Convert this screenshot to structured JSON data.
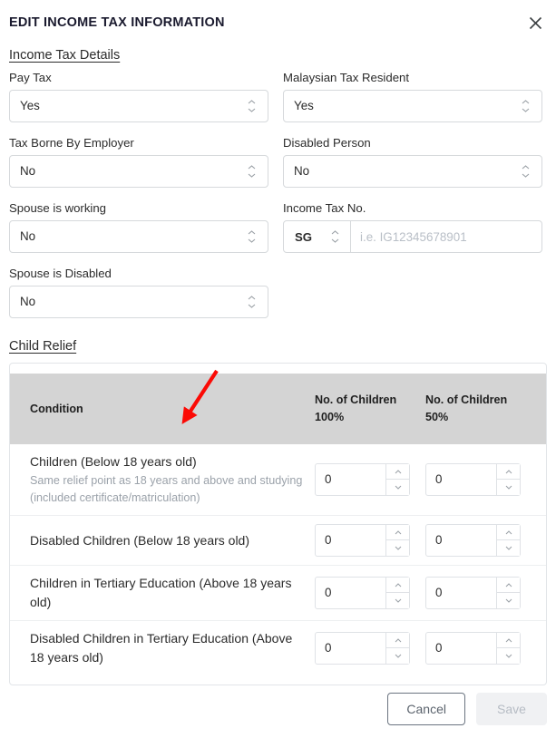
{
  "dialog": {
    "title": "EDIT INCOME TAX INFORMATION",
    "close_icon": "close-icon"
  },
  "sections": {
    "income_tax_details": "Income Tax Details",
    "child_relief": "Child Relief"
  },
  "fields": {
    "pay_tax": {
      "label": "Pay Tax",
      "value": "Yes"
    },
    "malaysian_tax_resident": {
      "label": "Malaysian Tax Resident",
      "value": "Yes"
    },
    "tax_borne_by_employer": {
      "label": "Tax Borne By Employer",
      "value": "No"
    },
    "disabled_person": {
      "label": "Disabled Person",
      "value": "No"
    },
    "spouse_is_working": {
      "label": "Spouse is working",
      "value": "No"
    },
    "income_tax_no": {
      "label": "Income Tax No.",
      "prefix": "SG",
      "value": "",
      "placeholder": "i.e. IG12345678901"
    },
    "spouse_is_disabled": {
      "label": "Spouse is Disabled",
      "value": "No"
    }
  },
  "child_relief_table": {
    "headers": {
      "condition": "Condition",
      "children_100": "No. of Children 100%",
      "children_100_line1": "No. of Children",
      "children_100_line2": "100%",
      "children_50_line1": "No. of Children",
      "children_50_line2": "50%"
    },
    "rows": [
      {
        "title": "Children (Below 18 years old)",
        "subtitle": "Same relief point as 18 years and above and studying (included certificate/matriculation)",
        "count_100": "0",
        "count_50": "0"
      },
      {
        "title": "Disabled Children (Below 18 years old)",
        "subtitle": "",
        "count_100": "0",
        "count_50": "0"
      },
      {
        "title": "Children in Tertiary Education (Above 18 years old)",
        "subtitle": "",
        "count_100": "0",
        "count_50": "0"
      },
      {
        "title": "Disabled Children in Tertiary Education (Above 18 years old)",
        "subtitle": "",
        "count_100": "0",
        "count_50": "0"
      }
    ]
  },
  "footer": {
    "cancel_label": "Cancel",
    "save_label": "Save"
  },
  "annotation": {
    "arrow_color": "#fb0a05"
  },
  "colors": {
    "table_header_bg": "#d4d4d4",
    "border": "#d6d9dc",
    "muted_text": "#9ba2aa",
    "save_disabled_text": "#b6bcc4"
  }
}
